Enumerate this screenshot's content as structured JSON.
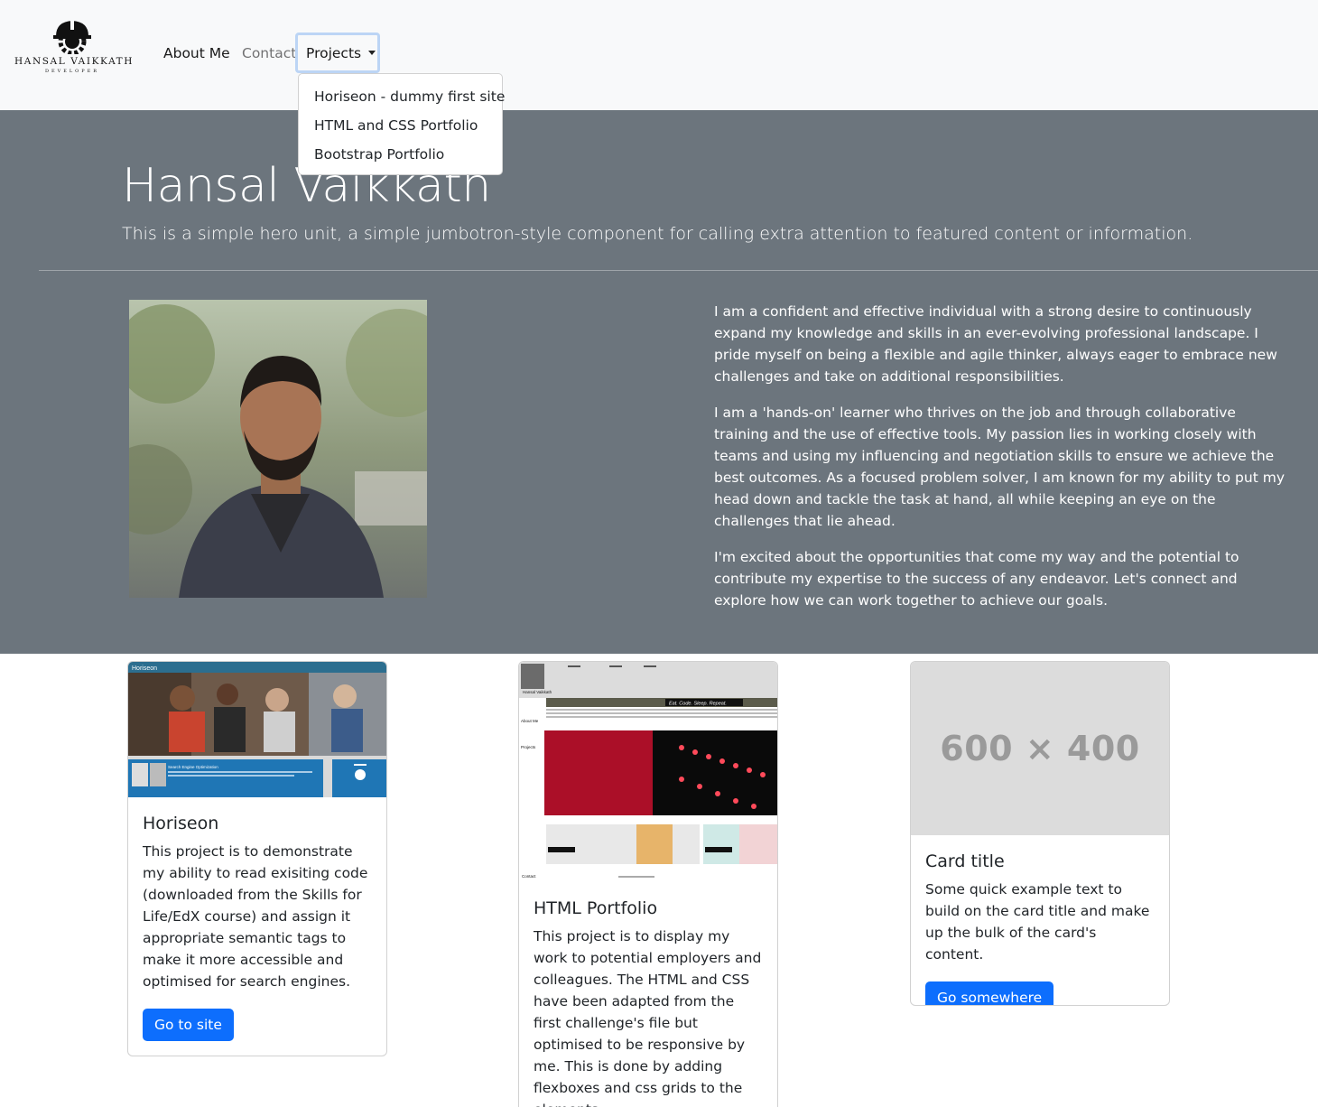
{
  "navbar": {
    "brand_name": "HANSAL VAIKKATH",
    "brand_sub": "DEVELOPER",
    "links": {
      "about": "About Me",
      "contact": "Contact",
      "projects": "Projects"
    },
    "dropdown": [
      "Horiseon - dummy first site",
      "HTML and CSS Portfolio",
      "Bootstrap Portfolio"
    ]
  },
  "hero": {
    "title": "Hansal Vaikkath",
    "lead": "This is a simple hero unit, a simple jumbotron-style component for calling extra attention to featured content or information.",
    "bio": [
      "I am a confident and effective individual with a strong desire to continuously expand my knowledge and skills in an ever-evolving professional landscape. I pride myself on being a flexible and agile thinker, always eager to embrace new challenges and take on additional responsibilities.",
      "I am a 'hands-on' learner who thrives on the job and through collaborative training and the use of effective tools. My passion lies in working closely with teams and using my influencing and negotiation skills to ensure we achieve the best outcomes. As a focused problem solver, I am known for my ability to put my head down and tackle the task at hand, all while keeping an eye on the challenges that lie ahead.",
      "I'm excited about the opportunities that come my way and the potential to contribute my expertise to the success of any endeavor. Let's connect and explore how we can work together to achieve our goals."
    ]
  },
  "cards": [
    {
      "title": "Horiseon",
      "text": "This project is to demonstrate my ability to read exisiting code (downloaded from the Skills for Life/EdX course) and assign it appropriate semantic tags to make it more accessible and optimised for search engines.",
      "button": "Go to site"
    },
    {
      "title": "HTML Portfolio",
      "text": "This project is to display my work to potential employers and colleagues. The HTML and CSS have been adapted from the first challenge's file but optimised to be responsive by me. This is done by adding flexboxes and css grids to the elements.",
      "button": ""
    },
    {
      "title": "Card title",
      "text": "Some quick example text to build on the card title and make up the bulk of the card's content.",
      "button": "Go somewhere",
      "placeholder": "600 × 400"
    }
  ],
  "thumb_texts": {
    "horiseon_brand": "Horiseon",
    "horiseon_section": "Search Engine Optimization",
    "portfolio_name": "Hansal Vaikkath",
    "portfolio_banner": "Eat. Code. Sleep. Repeat.",
    "portfolio_about": "About Me",
    "portfolio_projects": "Projects",
    "portfolio_contact": "Contact"
  },
  "colors": {
    "hero_bg": "#6c757d",
    "navbar_bg": "#f8f9fa",
    "primary": "#0d6efd",
    "focus_ring": "#bcd5f5"
  }
}
